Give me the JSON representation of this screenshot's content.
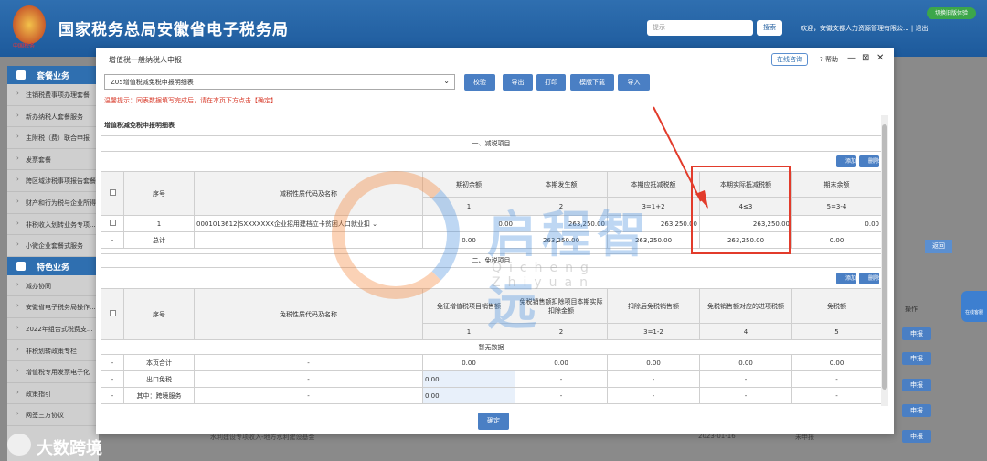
{
  "portal": {
    "title": "国家税务总局安徽省电子税务局",
    "emblem_text": "中国税务",
    "search_placeholder": "提示",
    "search_button": "搜索",
    "welcome": "欢迎，安徽文都人力资源管理有限公...",
    "logout": "| 退出",
    "green_badge": "切换旧版体验"
  },
  "sidebar": {
    "group1": "套餐业务",
    "items1": [
      "注销税费事项办理套餐",
      "新办纳税人套餐服务",
      "主附税（费）联合申报",
      "发票套餐",
      "跨区域涉税事项报告套餐",
      "财产和行为税与企业所得...",
      "非税收入划转业务专项...",
      "小微企业套餐式服务"
    ],
    "group2": "特色业务",
    "items2": [
      "减办协同",
      "安徽省电子税务局操作...",
      "2022年组合式税费支...",
      "非税划转政策专栏",
      "增值税专用发票电子化",
      "政策指引",
      "网签三方协议"
    ]
  },
  "background": {
    "return_btn": "返回",
    "operation_header": "操作",
    "apply_label": "申报",
    "row_text": "水利建设专项收入-地方水利建设基金",
    "row_date": "2023-01-16",
    "row_status": "未申报",
    "online_help": "在线客服"
  },
  "footer": {
    "brand": "大数跨境"
  },
  "modal": {
    "title": "增值税一般纳税人申报",
    "online_question": "在线咨询",
    "help": "帮助",
    "minimize": "—",
    "maximize": "⊠",
    "close": "✕",
    "select_value": "Z05增值税减免税申报明细表",
    "buttons": [
      "校验",
      "导出",
      "打印",
      "模版下载",
      "导入"
    ],
    "tip": "温馨提示：同表数据填写完成后，请在本页下方点击【确定】",
    "section_title": "增值税减免税申报明细表",
    "confirm": "确定"
  },
  "reduction": {
    "band_title": "一、减税项目",
    "add": "添加",
    "delete": "删除",
    "headers": [
      "序号",
      "减税性质代码及名称",
      "期初余额",
      "本期发生额",
      "本期应抵减税额",
      "本期实际抵减税额",
      "期末余额"
    ],
    "codes": [
      "1",
      "2",
      "3=1+2",
      "4≤3",
      "5=3-4"
    ],
    "row1": {
      "seq": "1",
      "name": "0001013612|SXXXXXXX企业招用建档立卡贫困人口就业扣",
      "opening": "0.00",
      "current": "263,250.00",
      "due": "263,250.00",
      "actual": "263,250.00",
      "closing": "0.00"
    },
    "total": {
      "seq": "-",
      "label": "总计",
      "opening": "0.00",
      "current": "263,250.00",
      "due": "263,250.00",
      "actual": "263,250.00",
      "closing": "0.00"
    }
  },
  "exemption": {
    "band_title": "二、免税项目",
    "add": "添加",
    "delete": "删除",
    "headers": [
      "序号",
      "免税性质代码及名称",
      "免征增值税项目销售额",
      "免税销售额扣除项目本期实际扣除金额",
      "扣除后免税销售额",
      "免税销售额对应的进项税额",
      "免税额"
    ],
    "codes": [
      "1",
      "2",
      "3=1-2",
      "4",
      "5"
    ],
    "no_data": "暂无数据",
    "rows": [
      {
        "seq": "-",
        "label": "本页合计",
        "name": "-",
        "c1": "0.00",
        "c2": "0.00",
        "c3": "0.00",
        "c4": "0.00",
        "c5": "0.00"
      },
      {
        "seq": "-",
        "label": "出口免税",
        "name": "-",
        "c1": "0.00",
        "c2": "-",
        "c3": "-",
        "c4": "-",
        "c5": "-"
      },
      {
        "seq": "-",
        "label": "其中：跨境服务",
        "name": "-",
        "c1": "0.00",
        "c2": "-",
        "c3": "-",
        "c4": "-",
        "c5": "-"
      }
    ]
  },
  "watermark": {
    "text": "启程智远",
    "sub": "Qicheng Zhiyuan"
  }
}
